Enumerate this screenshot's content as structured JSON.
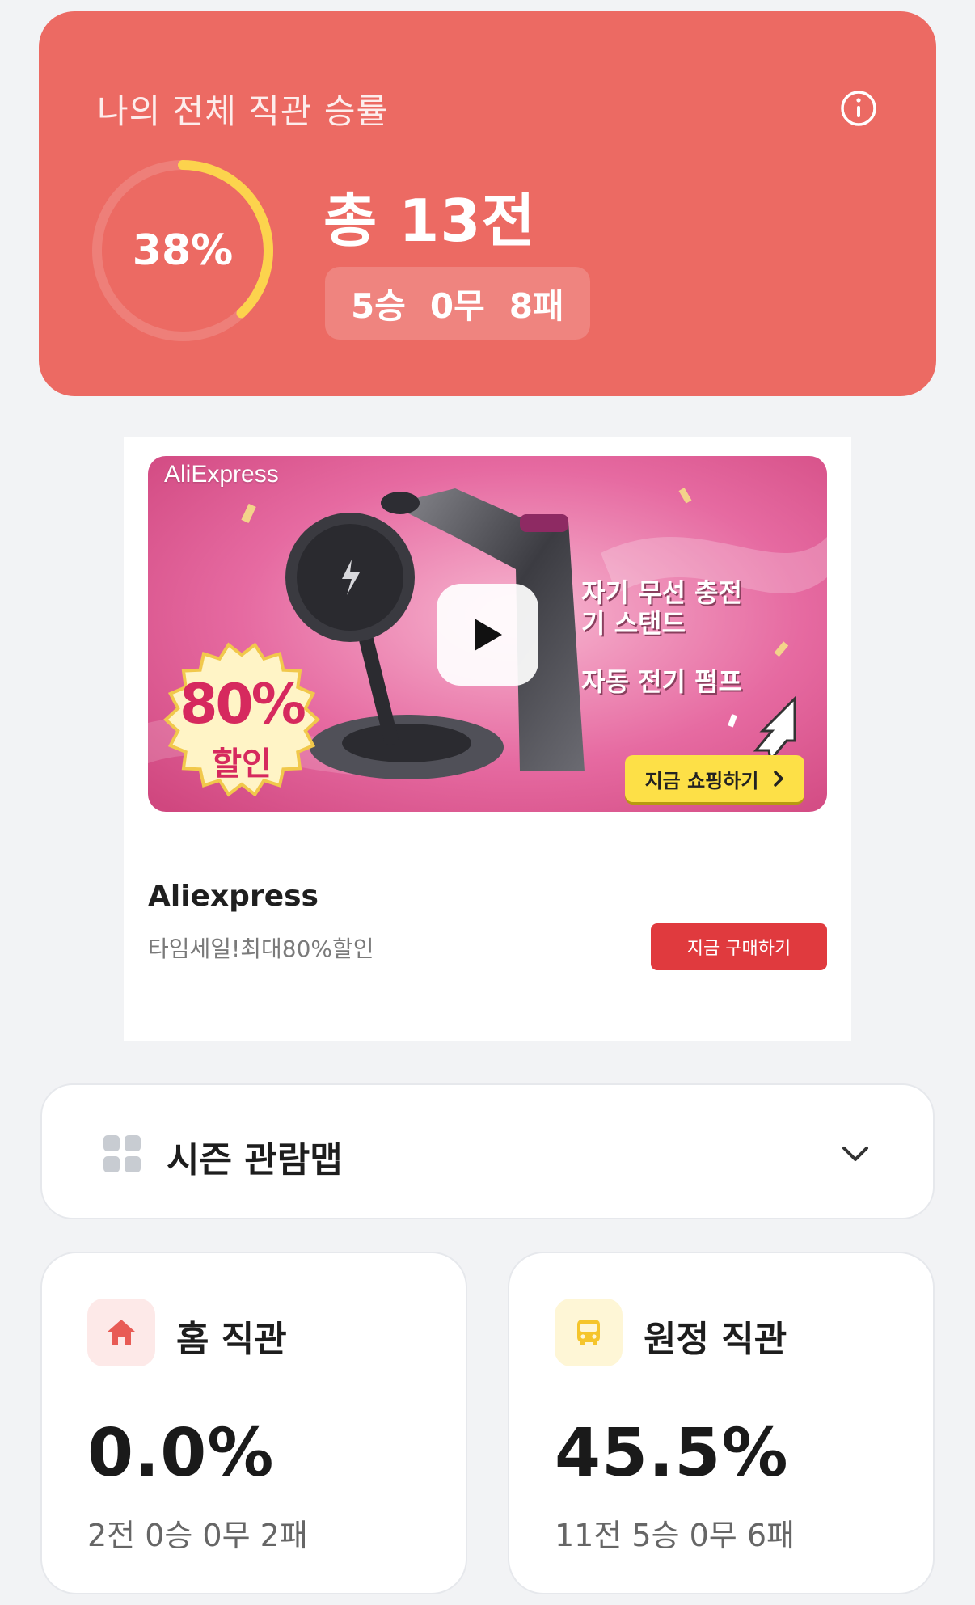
{
  "winrate": {
    "title": "나의 전체 직관 승률",
    "percent_label": "38%",
    "percent_value": 38,
    "total_label": "총 13전",
    "record": {
      "wins": "5승",
      "draws": "0무",
      "losses": "8패"
    },
    "colors": {
      "card": "#ec6a63",
      "ring_progress": "#fcd34d"
    }
  },
  "ad": {
    "banner": {
      "brand": "AliExpress",
      "headline": "자기 무선 충전기 스탠드",
      "subline": "자동 전기 펌프",
      "discount_big": "80%",
      "discount_small": "할인",
      "shop_button": "지금 쇼핑하기"
    },
    "advertiser": "Aliexpress",
    "description": "타임세일!최대80%할인",
    "cta_label": "지금 구매하기"
  },
  "season": {
    "label": "시즌 관람맵"
  },
  "home": {
    "title": "홈 직관",
    "rate": "0.0%",
    "record": "2전 0승 0무 2패",
    "icon": "home-icon"
  },
  "away": {
    "title": "원정 직관",
    "rate": "45.5%",
    "record": "11전 5승 0무 6패",
    "icon": "bus-icon"
  }
}
